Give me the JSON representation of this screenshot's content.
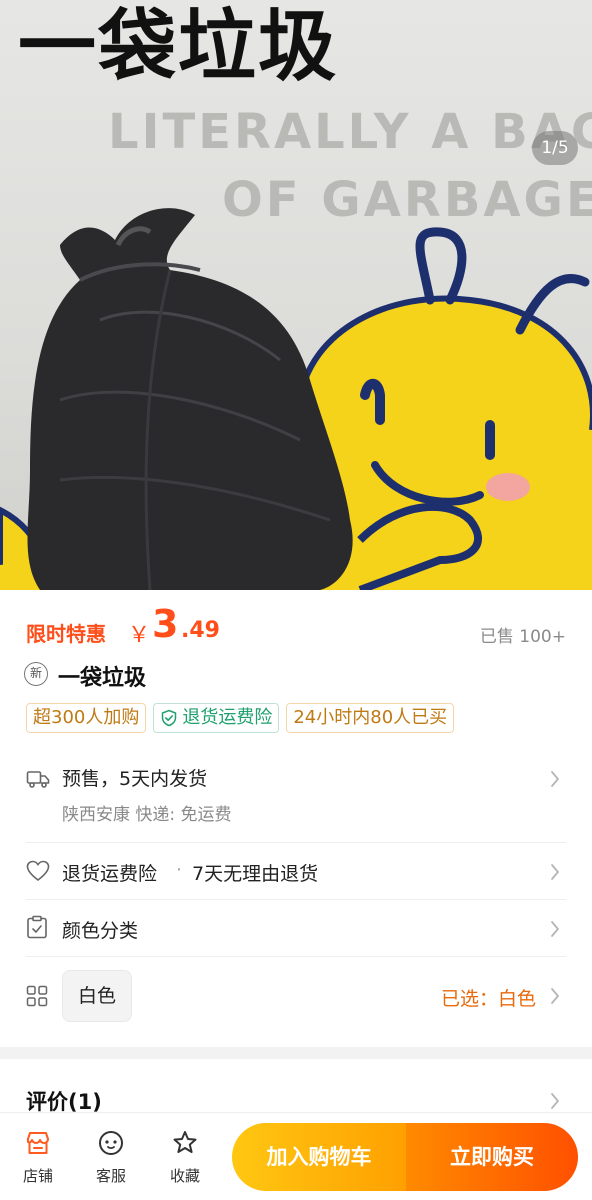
{
  "hero": {
    "title": "一袋垃圾",
    "subtitle_line1": "LITERALLY A BAG",
    "subtitle_line2": "OF GARBAGE",
    "page_indicator": "1/5"
  },
  "price": {
    "promo_label": "限时特惠",
    "currency": "￥",
    "integer": "3",
    "decimal": ".49",
    "sold": "已售 100+"
  },
  "product": {
    "new_badge": "新",
    "title": "一袋垃圾"
  },
  "tags": [
    {
      "label": "超300人加购",
      "icon": null
    },
    {
      "label": "退货运费险",
      "icon": "shield-check-icon"
    },
    {
      "label": "24小时内80人已买",
      "icon": null
    }
  ],
  "shipping": {
    "icon": "truck-icon",
    "main": "预售，5天内发货",
    "sub": "陕西安康  快递: 免运费"
  },
  "guarantee": {
    "icon": "heart-icon",
    "main": "退货运费险",
    "separator": "·",
    "detail": "7天无理由退货"
  },
  "variant": {
    "icon": "clipboard-check-icon",
    "label": "颜色分类",
    "grid_icon": "grid-icon",
    "option": "白色",
    "selected": "已选：白色"
  },
  "reviews": {
    "title": "评价(1)"
  },
  "bottom_bar": {
    "shop_label": "店铺",
    "service_label": "客服",
    "favorite_label": "收藏",
    "add_to_cart": "加入购物车",
    "buy_now": "立即购买"
  },
  "colors": {
    "accent": "#ff4e1a",
    "orange": "#e86a0c",
    "cart_gradient": [
      "#ffc712",
      "#ffa000"
    ],
    "buy_gradient": [
      "#ff8a00",
      "#ff5000"
    ]
  }
}
